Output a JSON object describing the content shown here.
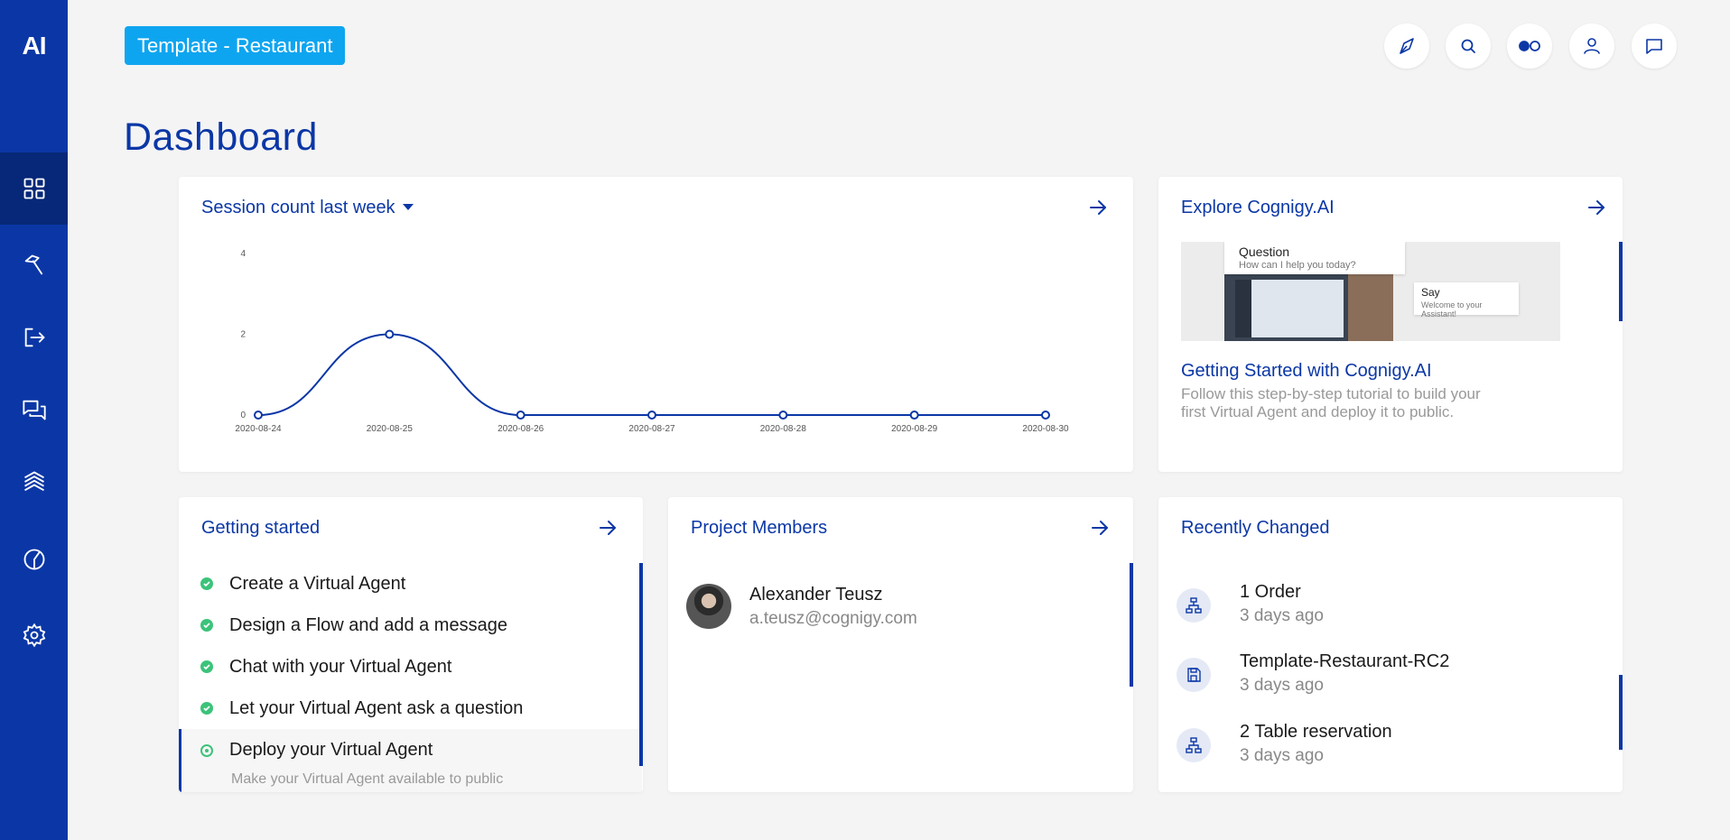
{
  "app": {
    "logo": "AI"
  },
  "sidebar": {
    "items": [
      {
        "name": "dashboard",
        "icon": "grid-icon",
        "active": true
      },
      {
        "name": "build",
        "icon": "hammer-icon"
      },
      {
        "name": "deploy",
        "icon": "deploy-icon"
      },
      {
        "name": "chat",
        "icon": "chat-icon"
      },
      {
        "name": "manage",
        "icon": "layers-icon"
      },
      {
        "name": "analyze",
        "icon": "pie-chart-icon"
      },
      {
        "name": "settings",
        "icon": "gear-icon"
      }
    ]
  },
  "header": {
    "project": "Template - Restaurant",
    "buttons": [
      "compass-icon",
      "search-icon",
      "toggle-icon",
      "user-icon",
      "chat-bubble-icon"
    ]
  },
  "page": {
    "title": "Dashboard"
  },
  "session_card": {
    "title": "Session count last week"
  },
  "chart_data": {
    "type": "line",
    "title": "Session count last week",
    "categories": [
      "2020-08-24",
      "2020-08-25",
      "2020-08-26",
      "2020-08-27",
      "2020-08-28",
      "2020-08-29",
      "2020-08-30"
    ],
    "series": [
      {
        "values": [
          0,
          2,
          0,
          0,
          0,
          0,
          0
        ]
      }
    ],
    "ylim": [
      0,
      4
    ],
    "yticks": [
      "0",
      "2",
      "4"
    ],
    "grid": false,
    "color": "#0b37a6"
  },
  "explore_card": {
    "title": "Explore Cognigy.AI",
    "image_question": "Question",
    "image_question_sub": "How can I help you today?",
    "image_say": "Say",
    "image_say_sub": "Welcome to your Assistant!",
    "article_title": "Getting Started with Cognigy.AI",
    "article_desc_line1": "Follow this step-by-step tutorial to build your",
    "article_desc_line2": "first Virtual Agent and deploy it to public."
  },
  "getting_started": {
    "title": "Getting started",
    "items": [
      {
        "label": "Create a Virtual Agent",
        "done": true
      },
      {
        "label": "Design a Flow and add a message",
        "done": true
      },
      {
        "label": "Chat with your Virtual Agent",
        "done": true
      },
      {
        "label": "Let your Virtual Agent ask a question",
        "done": true
      },
      {
        "label": "Deploy your Virtual Agent",
        "done": false,
        "sub": "Make your Virtual Agent available to public"
      }
    ]
  },
  "members": {
    "title": "Project Members",
    "items": [
      {
        "name": "Alexander Teusz",
        "email": "a.teusz@cognigy.com"
      }
    ]
  },
  "recent": {
    "title": "Recently Changed",
    "items": [
      {
        "name": "1 Order",
        "time": "3 days ago",
        "icon": "flow-icon"
      },
      {
        "name": "Template-Restaurant-RC2",
        "time": "3 days ago",
        "icon": "save-icon"
      },
      {
        "name": "2 Table reservation",
        "time": "3 days ago",
        "icon": "flow-icon"
      }
    ]
  }
}
